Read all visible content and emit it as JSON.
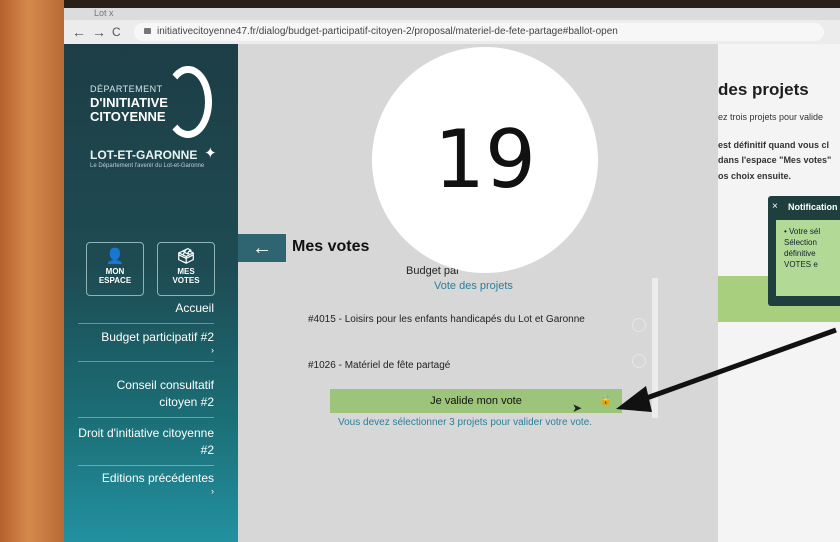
{
  "browser": {
    "tab_label": "Lot x",
    "url": "initiativecitoyenne47.fr/dialog/budget-participatif-citoyen-2/proposal/materiel-de-fete-partage#ballot-open",
    "back_glyph": "←",
    "forward_glyph": "→",
    "reload_glyph": "C"
  },
  "overlay_badge": "19",
  "sidebar": {
    "logo_small": "DÉPARTEMENT",
    "logo_line1": "D'INITIATIVE",
    "logo_line2": "CITOYENNE",
    "department": "LOT-ET-GARONNE",
    "department_sub": "Le Département l'avenir du Lot-et-Garonne",
    "buttons": [
      {
        "line1": "MON",
        "line2": "ESPACE",
        "icon": "user-icon"
      },
      {
        "line1": "MES",
        "line2": "VOTES",
        "icon": "ballot-icon"
      }
    ],
    "menu": [
      {
        "label": "Accueil",
        "chevron": ""
      },
      {
        "label": "Budget participatif #2",
        "chevron": "›"
      },
      {
        "label": "Conseil consultatif citoyen #2",
        "chevron": ""
      },
      {
        "label": "Droit d'initiative citoyenne #2",
        "chevron": ""
      },
      {
        "label": "Editions précédentes",
        "chevron": "›"
      }
    ]
  },
  "main": {
    "back_arrow": "←",
    "title": "Mes votes",
    "budget_line": "Budget par",
    "vote_link": "Vote des projets",
    "projects": [
      {
        "label": "#4015 - Loisirs pour les enfants handicapés du Lot et Garonne"
      },
      {
        "label": "#1026 - Matériel de fête partagé"
      }
    ],
    "validate_label": "Je valide mon vote",
    "validate_lock": "🔒",
    "hint": "Vous devez sélectionner 3 projets pour valider votre vote."
  },
  "right_panel": {
    "title": "des projets",
    "lines": [
      "ez trois projets pour valide",
      "est définitif quand vous cl",
      "dans l'espace \"Mes votes\"",
      "os choix ensuite."
    ],
    "notification": {
      "close": "×",
      "title": "Notification",
      "body_lines": [
        "• Votre sél",
        "Sélection",
        "définitive",
        "VOTES e"
      ]
    }
  },
  "colors": {
    "sidebar_top": "#1d3e46",
    "sidebar_bottom": "#2391a0",
    "validate_green": "#9cc47a",
    "link_teal": "#2a7f9a"
  }
}
